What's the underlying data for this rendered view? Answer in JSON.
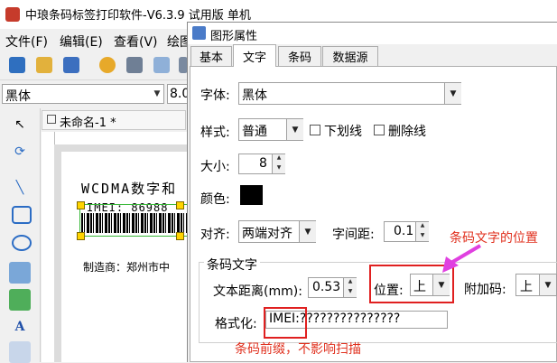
{
  "app": {
    "title": "中琅条码标签打印软件-V6.3.9 试用版 单机"
  },
  "menu": [
    {
      "label": "文件(F)"
    },
    {
      "label": "编辑(E)"
    },
    {
      "label": "查看(V)"
    },
    {
      "label": "绘图"
    }
  ],
  "font_bar": {
    "font": "黑体",
    "size": "8.0"
  },
  "document": {
    "tab": "未命名-1 *",
    "barcode_title": "WCDMA数字和",
    "barcode_imei": "IMEI: 86988",
    "maker": "制造商：郑州市中"
  },
  "dialog": {
    "title": "图形属性",
    "tabs": [
      "基本",
      "文字",
      "条码",
      "数据源"
    ],
    "active_tab": "文字",
    "font_label": "字体:",
    "font_value": "黑体",
    "style_label": "样式:",
    "style_value": "普通",
    "underline_label": "下划线",
    "strike_label": "删除线",
    "size_label": "大小:",
    "size_value": "8",
    "color_label": "颜色:",
    "color_value": "#000000",
    "align_label": "对齐:",
    "align_value": "两端对齐",
    "spacing_label": "字间距:",
    "spacing_value": "0.1",
    "group_title": "条码文字",
    "distance_label": "文本距离(mm):",
    "distance_value": "0.53",
    "position_label": "位置:",
    "position_value": "上",
    "addon_label": "附加码:",
    "addon_value": "上",
    "format_label": "格式化:",
    "format_value": "IMEI:???????????????"
  },
  "annotations": {
    "position_note": "条码文字的位置",
    "prefix_note": "条码前缀，不影响扫描",
    "accent_color": "#e0301e",
    "arrow_color": "#e040e0"
  }
}
